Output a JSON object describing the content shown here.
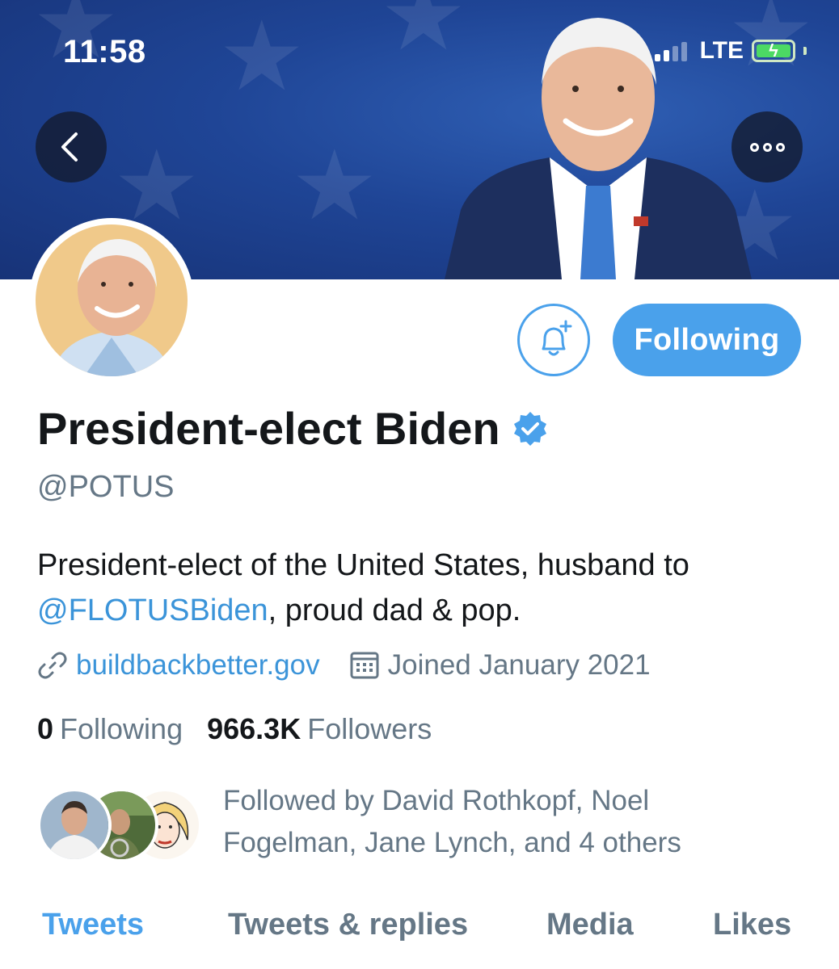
{
  "status_bar": {
    "time": "11:58",
    "network": "LTE",
    "icons": [
      "signal-icon",
      "battery-charging-icon"
    ]
  },
  "header": {
    "back_icon": "chevron-left-icon",
    "more_icon": "more-options-icon"
  },
  "profile": {
    "display_name": "President-elect Biden",
    "handle": "@POTUS",
    "bio_text": "President-elect of the United States, husband to ",
    "bio_mention": "@FLOTUSBiden",
    "bio_end": ", proud dad & pop.",
    "website": "buildbackbetter.gov",
    "joined": "Joined January 2021",
    "verified_icon": "verified-badge-icon"
  },
  "actions": {
    "notify_icon": "bell-plus-icon",
    "following_label": "Following"
  },
  "stats": {
    "following_count": "0",
    "following_label": "Following",
    "followers_count": "966.3K",
    "followers_label": "Followers"
  },
  "followed_by": {
    "line1": "Followed by David Rothkopf, Noel",
    "line2": "Fogelman, Jane Lynch, and 4 others"
  },
  "tabs": [
    {
      "label": "Tweets",
      "active": true
    },
    {
      "label": "Tweets & replies",
      "active": false
    },
    {
      "label": "Media",
      "active": false
    },
    {
      "label": "Likes",
      "active": false
    }
  ],
  "colors": {
    "accent": "#4aa1eb",
    "link": "#3b94d9",
    "banner": "#1f4596",
    "secondary_text": "#657786"
  }
}
